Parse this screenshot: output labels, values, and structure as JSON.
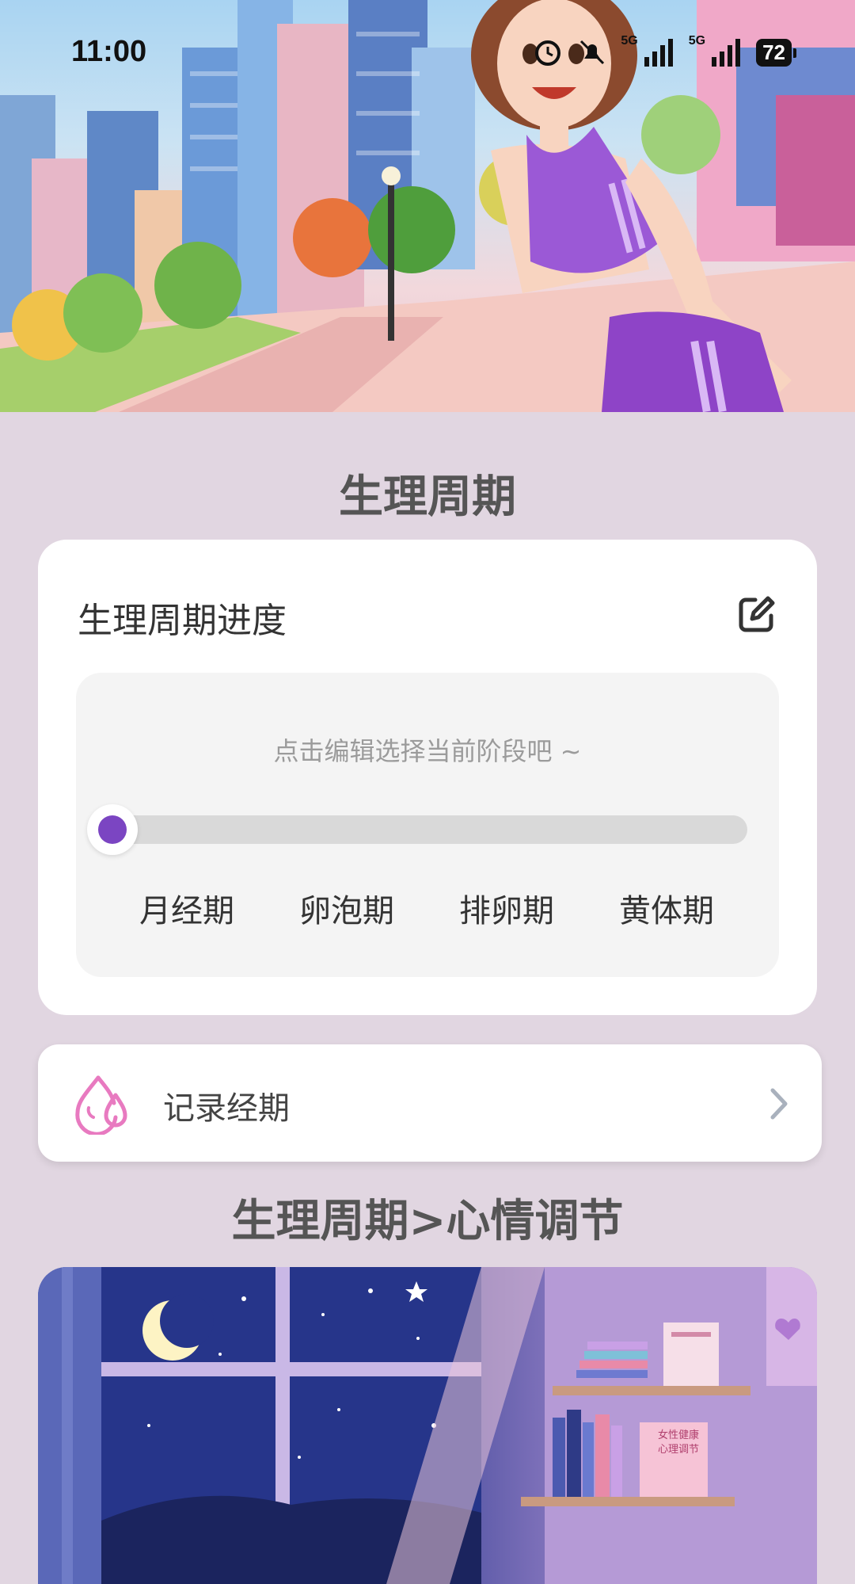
{
  "status_bar": {
    "time": "11:00",
    "network_1": "5G",
    "network_2": "5G",
    "battery": "72"
  },
  "page": {
    "title": "生理周期"
  },
  "progress_card": {
    "title": "生理周期进度",
    "hint": "点击编辑选择当前阶段吧 ~",
    "current_phase_fraction": 0,
    "phases": [
      "月经期",
      "卵泡期",
      "排卵期",
      "黄体期"
    ]
  },
  "record": {
    "label": "记录经期"
  },
  "mood_section": {
    "title": "生理周期>心情调节"
  },
  "book_text": {
    "line1": "女性健康",
    "line2": "心理调节"
  },
  "colors": {
    "background": "#e1d6e1",
    "accent_purple": "#7b45c2",
    "icon_pink": "#e87ac0"
  },
  "icons": {
    "edit": "edit-icon",
    "drop": "drop-icon",
    "chevron": "chevron-right-icon"
  }
}
